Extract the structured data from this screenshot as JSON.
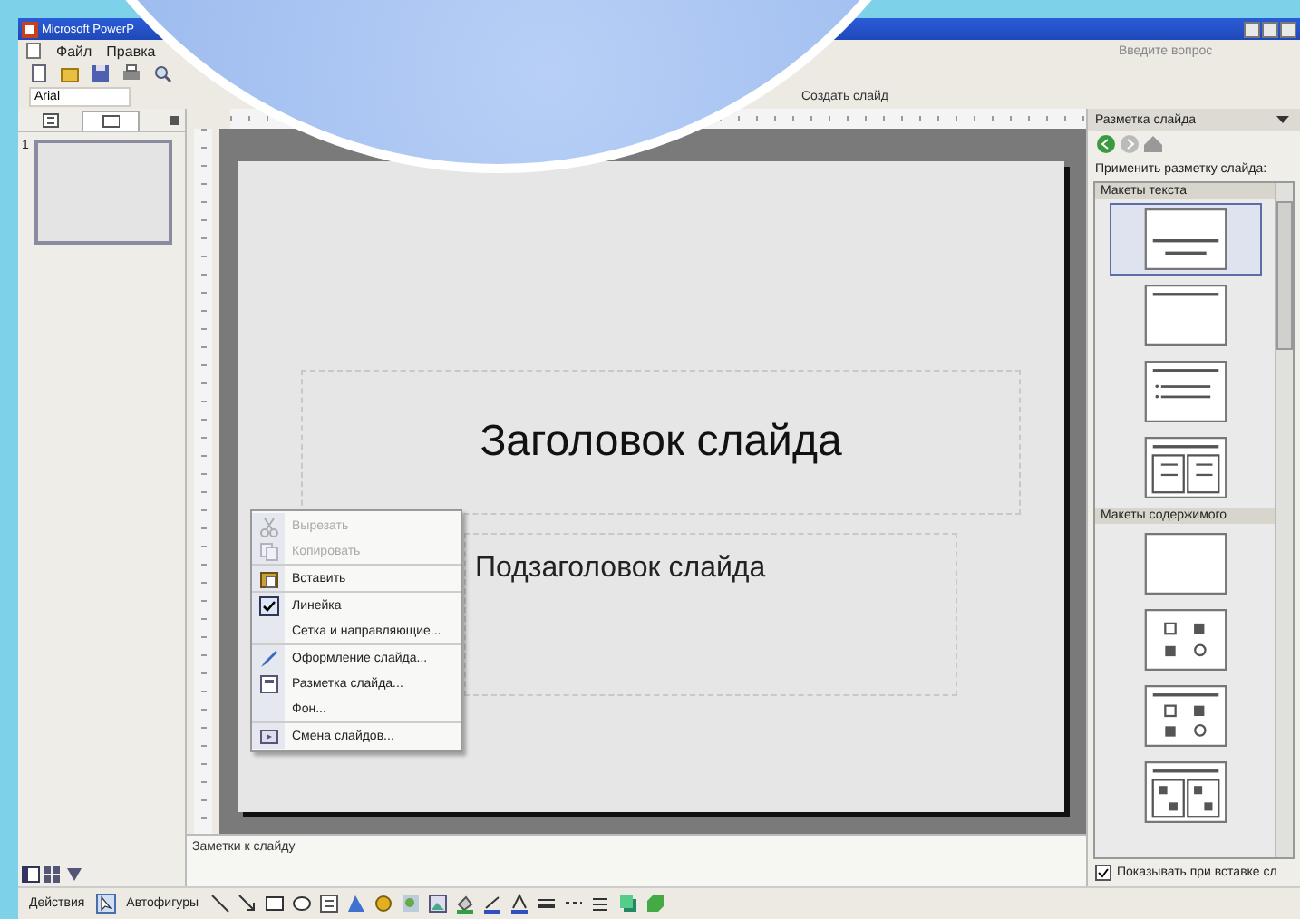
{
  "window": {
    "title": "Microsoft PowerP"
  },
  "menu": [
    {
      "label": "Файл"
    },
    {
      "label": "Правка"
    }
  ],
  "help_box": {
    "placeholder": "Введите вопрос"
  },
  "font_field": {
    "value": "Arial"
  },
  "new_slide_button": {
    "label": "Создать слайд"
  },
  "slides_panel": {
    "tabs": [
      {
        "kind": "outline",
        "selected": false
      },
      {
        "kind": "slides",
        "selected": true
      }
    ],
    "thumbnails": [
      {
        "number": "1",
        "selected": true
      }
    ]
  },
  "slide": {
    "title": "Заголовок слайда",
    "subtitle": "Подзаголовок слайда"
  },
  "context_menu": [
    {
      "label": "Вырезать",
      "disabled": true,
      "checked": false,
      "kind": "scissors"
    },
    {
      "label": "Копировать",
      "disabled": true,
      "checked": false,
      "kind": "copy"
    },
    {
      "label": "Вставить",
      "disabled": false,
      "checked": false,
      "kind": "paste"
    },
    {
      "label": "Линейка",
      "disabled": false,
      "checked": true,
      "kind": "none"
    },
    {
      "label": "Сетка и направляющие...",
      "disabled": false,
      "checked": false,
      "kind": "none"
    },
    {
      "label": "Оформление слайда...",
      "disabled": false,
      "checked": false,
      "kind": "design"
    },
    {
      "label": "Разметка слайда...",
      "disabled": false,
      "checked": false,
      "kind": "layout"
    },
    {
      "label": "Фон...",
      "disabled": false,
      "checked": false,
      "kind": "none"
    },
    {
      "label": "Смена слайдов...",
      "disabled": false,
      "checked": false,
      "kind": "transition"
    }
  ],
  "task_pane": {
    "title": "Разметка слайда",
    "label": "Применить разметку слайда:",
    "sections": [
      {
        "heading": "Макеты текста",
        "layouts": [
          {
            "kind": "title",
            "selected": true
          },
          {
            "kind": "title-only",
            "selected": false
          },
          {
            "kind": "title-text",
            "selected": false
          },
          {
            "kind": "two-column",
            "selected": false
          }
        ]
      },
      {
        "heading": "Макеты содержимого",
        "layouts": [
          {
            "kind": "blank",
            "selected": false
          },
          {
            "kind": "content",
            "selected": false
          },
          {
            "kind": "title-content",
            "selected": false
          },
          {
            "kind": "title-two-content",
            "selected": false
          }
        ]
      }
    ],
    "show_on_insert": {
      "label": "Показывать при вставке сл",
      "checked": true
    }
  },
  "notes": {
    "placeholder": "Заметки к слайду"
  },
  "drawing_toolbar": {
    "actions": "Действия",
    "autoshapes": "Автофигуры"
  }
}
